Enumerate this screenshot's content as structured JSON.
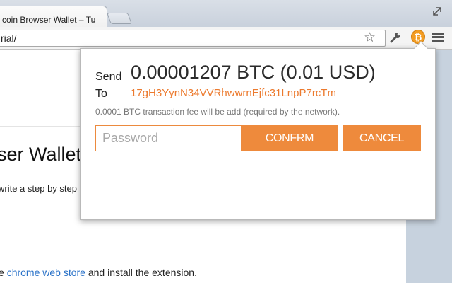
{
  "browser": {
    "tab_title": "coin Browser Wallet – Tu",
    "tab_close": "×",
    "url": "rial/"
  },
  "page": {
    "heading": "ser Wallet",
    "intro": "write a step by step",
    "install_prefix": "e ",
    "install_link": "chrome web store",
    "install_suffix": " and install the extension."
  },
  "popup": {
    "send_label": "Send",
    "send_amount": "0.00001207 BTC (0.01 USD)",
    "to_label": "To",
    "to_address": "17gH3YynN34VVRhwwrnEjfc31LnpP7rcTm",
    "fee_note": "0.0001 BTC transaction fee will be add (required by the network).",
    "password_placeholder": "Password",
    "confirm_label": "CONFRM",
    "cancel_label": "CANCEL"
  },
  "colors": {
    "accent": "#ee8a3c",
    "address": "#ec7a2e"
  }
}
